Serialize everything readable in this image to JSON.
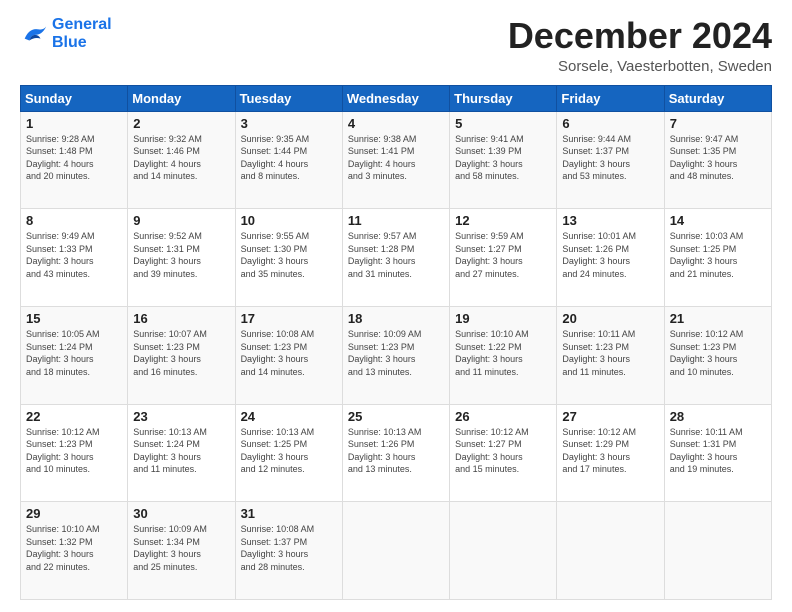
{
  "logo": {
    "line1": "General",
    "line2": "Blue"
  },
  "title": "December 2024",
  "subtitle": "Sorsele, Vaesterbotten, Sweden",
  "days_of_week": [
    "Sunday",
    "Monday",
    "Tuesday",
    "Wednesday",
    "Thursday",
    "Friday",
    "Saturday"
  ],
  "weeks": [
    [
      {
        "day": "1",
        "info": "Sunrise: 9:28 AM\nSunset: 1:48 PM\nDaylight: 4 hours\nand 20 minutes."
      },
      {
        "day": "2",
        "info": "Sunrise: 9:32 AM\nSunset: 1:46 PM\nDaylight: 4 hours\nand 14 minutes."
      },
      {
        "day": "3",
        "info": "Sunrise: 9:35 AM\nSunset: 1:44 PM\nDaylight: 4 hours\nand 8 minutes."
      },
      {
        "day": "4",
        "info": "Sunrise: 9:38 AM\nSunset: 1:41 PM\nDaylight: 4 hours\nand 3 minutes."
      },
      {
        "day": "5",
        "info": "Sunrise: 9:41 AM\nSunset: 1:39 PM\nDaylight: 3 hours\nand 58 minutes."
      },
      {
        "day": "6",
        "info": "Sunrise: 9:44 AM\nSunset: 1:37 PM\nDaylight: 3 hours\nand 53 minutes."
      },
      {
        "day": "7",
        "info": "Sunrise: 9:47 AM\nSunset: 1:35 PM\nDaylight: 3 hours\nand 48 minutes."
      }
    ],
    [
      {
        "day": "8",
        "info": "Sunrise: 9:49 AM\nSunset: 1:33 PM\nDaylight: 3 hours\nand 43 minutes."
      },
      {
        "day": "9",
        "info": "Sunrise: 9:52 AM\nSunset: 1:31 PM\nDaylight: 3 hours\nand 39 minutes."
      },
      {
        "day": "10",
        "info": "Sunrise: 9:55 AM\nSunset: 1:30 PM\nDaylight: 3 hours\nand 35 minutes."
      },
      {
        "day": "11",
        "info": "Sunrise: 9:57 AM\nSunset: 1:28 PM\nDaylight: 3 hours\nand 31 minutes."
      },
      {
        "day": "12",
        "info": "Sunrise: 9:59 AM\nSunset: 1:27 PM\nDaylight: 3 hours\nand 27 minutes."
      },
      {
        "day": "13",
        "info": "Sunrise: 10:01 AM\nSunset: 1:26 PM\nDaylight: 3 hours\nand 24 minutes."
      },
      {
        "day": "14",
        "info": "Sunrise: 10:03 AM\nSunset: 1:25 PM\nDaylight: 3 hours\nand 21 minutes."
      }
    ],
    [
      {
        "day": "15",
        "info": "Sunrise: 10:05 AM\nSunset: 1:24 PM\nDaylight: 3 hours\nand 18 minutes."
      },
      {
        "day": "16",
        "info": "Sunrise: 10:07 AM\nSunset: 1:23 PM\nDaylight: 3 hours\nand 16 minutes."
      },
      {
        "day": "17",
        "info": "Sunrise: 10:08 AM\nSunset: 1:23 PM\nDaylight: 3 hours\nand 14 minutes."
      },
      {
        "day": "18",
        "info": "Sunrise: 10:09 AM\nSunset: 1:23 PM\nDaylight: 3 hours\nand 13 minutes."
      },
      {
        "day": "19",
        "info": "Sunrise: 10:10 AM\nSunset: 1:22 PM\nDaylight: 3 hours\nand 11 minutes."
      },
      {
        "day": "20",
        "info": "Sunrise: 10:11 AM\nSunset: 1:23 PM\nDaylight: 3 hours\nand 11 minutes."
      },
      {
        "day": "21",
        "info": "Sunrise: 10:12 AM\nSunset: 1:23 PM\nDaylight: 3 hours\nand 10 minutes."
      }
    ],
    [
      {
        "day": "22",
        "info": "Sunrise: 10:12 AM\nSunset: 1:23 PM\nDaylight: 3 hours\nand 10 minutes."
      },
      {
        "day": "23",
        "info": "Sunrise: 10:13 AM\nSunset: 1:24 PM\nDaylight: 3 hours\nand 11 minutes."
      },
      {
        "day": "24",
        "info": "Sunrise: 10:13 AM\nSunset: 1:25 PM\nDaylight: 3 hours\nand 12 minutes."
      },
      {
        "day": "25",
        "info": "Sunrise: 10:13 AM\nSunset: 1:26 PM\nDaylight: 3 hours\nand 13 minutes."
      },
      {
        "day": "26",
        "info": "Sunrise: 10:12 AM\nSunset: 1:27 PM\nDaylight: 3 hours\nand 15 minutes."
      },
      {
        "day": "27",
        "info": "Sunrise: 10:12 AM\nSunset: 1:29 PM\nDaylight: 3 hours\nand 17 minutes."
      },
      {
        "day": "28",
        "info": "Sunrise: 10:11 AM\nSunset: 1:31 PM\nDaylight: 3 hours\nand 19 minutes."
      }
    ],
    [
      {
        "day": "29",
        "info": "Sunrise: 10:10 AM\nSunset: 1:32 PM\nDaylight: 3 hours\nand 22 minutes."
      },
      {
        "day": "30",
        "info": "Sunrise: 10:09 AM\nSunset: 1:34 PM\nDaylight: 3 hours\nand 25 minutes."
      },
      {
        "day": "31",
        "info": "Sunrise: 10:08 AM\nSunset: 1:37 PM\nDaylight: 3 hours\nand 28 minutes."
      },
      {
        "day": "",
        "info": ""
      },
      {
        "day": "",
        "info": ""
      },
      {
        "day": "",
        "info": ""
      },
      {
        "day": "",
        "info": ""
      }
    ]
  ]
}
